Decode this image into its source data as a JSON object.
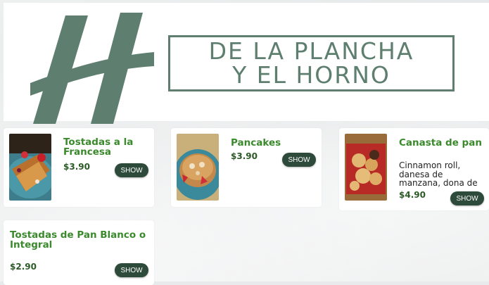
{
  "header": {
    "title_line1": "DE LA PLANCHA",
    "title_line2": "Y EL HORNO"
  },
  "colors": {
    "brand_green": "#5e7f70",
    "title_green": "#3a8a2c",
    "button_dark": "#2d4a3a"
  },
  "items": [
    {
      "name": "Tostadas a la Francesa",
      "price": "$3.90",
      "button": "SHOW"
    },
    {
      "name": "Pancakes",
      "price": "$3.90",
      "button": "SHOW"
    },
    {
      "name": "Canasta de pan",
      "description": "Cinnamon roll, danesa de manzana, dona de caramelo y",
      "price": "$4.90",
      "button": "SHOW"
    },
    {
      "name": "Tostadas de Pan Blanco o Integral",
      "price": "$2.90",
      "button": "SHOW"
    }
  ]
}
